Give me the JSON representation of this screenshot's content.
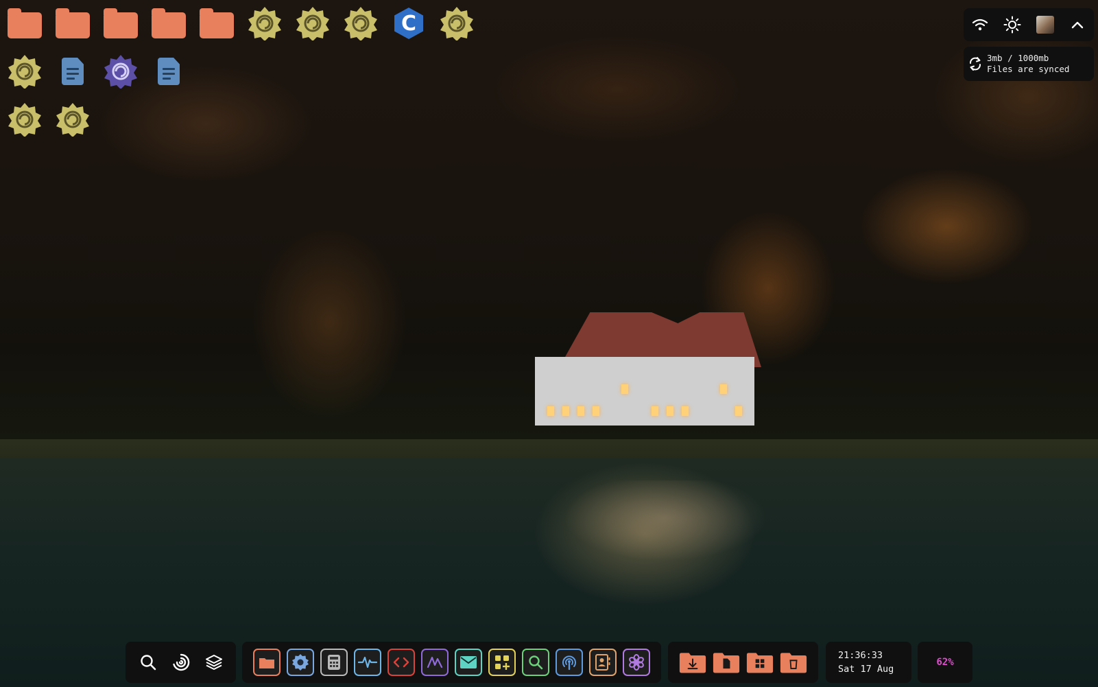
{
  "desktop": {
    "icons": [
      {
        "name": "folder-1",
        "kind": "folder"
      },
      {
        "name": "folder-2",
        "kind": "folder"
      },
      {
        "name": "folder-3",
        "kind": "folder"
      },
      {
        "name": "folder-4",
        "kind": "folder"
      },
      {
        "name": "folder-5",
        "kind": "folder"
      },
      {
        "name": "app-gear-1",
        "kind": "gear"
      },
      {
        "name": "app-gear-2",
        "kind": "gear"
      },
      {
        "name": "app-gear-3",
        "kind": "gear"
      },
      {
        "name": "c-language",
        "kind": "c-hexagon",
        "glyph": "C"
      },
      {
        "name": "app-gear-4",
        "kind": "gear"
      },
      {
        "name": "app-gear-5",
        "kind": "gear"
      },
      {
        "name": "text-document-1",
        "kind": "document"
      },
      {
        "name": "app-gear-purple",
        "kind": "gear-purple"
      },
      {
        "name": "text-document-2",
        "kind": "document"
      },
      {
        "name": "app-gear-6",
        "kind": "gear"
      },
      {
        "name": "app-gear-7",
        "kind": "gear"
      }
    ]
  },
  "tray": {
    "icons": [
      "wifi-icon",
      "brightness-icon",
      "user-avatar",
      "chevron-up-icon"
    ]
  },
  "sync": {
    "usage": "3mb / 1000mb",
    "status": "Files are synced"
  },
  "dock": {
    "launcher": [
      "search-icon",
      "launcher-swirl-icon",
      "layers-icon"
    ],
    "apps": [
      {
        "name": "files",
        "color": "#e9805d"
      },
      {
        "name": "settings",
        "color": "#7aa7e0"
      },
      {
        "name": "calculator",
        "color": "#b9b9b9"
      },
      {
        "name": "system-monitor",
        "color": "#6fb6e8"
      },
      {
        "name": "code-editor",
        "color": "#d8433c"
      },
      {
        "name": "graphs",
        "color": "#8f6ad8"
      },
      {
        "name": "mail",
        "color": "#5fd3c3"
      },
      {
        "name": "app-grid",
        "color": "#e2d25a"
      },
      {
        "name": "search-app",
        "color": "#6cd27a"
      },
      {
        "name": "podcasts",
        "color": "#5f9be0"
      },
      {
        "name": "contacts",
        "color": "#e0a56a"
      },
      {
        "name": "flower",
        "color": "#b07ae0"
      }
    ],
    "places": [
      "downloads-folder-icon",
      "documents-folder-icon",
      "apps-folder-icon",
      "trash-folder-icon"
    ],
    "places_color": "#e9805d"
  },
  "clock": {
    "time": "21:36:33",
    "date": "Sat 17 Aug"
  },
  "battery": {
    "percent": "62%",
    "color": "#e24bd0"
  },
  "colors": {
    "folder": "#e9805d",
    "gear": "#c9bf6a",
    "gear_purple": "#5b4fa8",
    "document": "#5f8dc0",
    "c_logo": "#2f6fc7"
  }
}
